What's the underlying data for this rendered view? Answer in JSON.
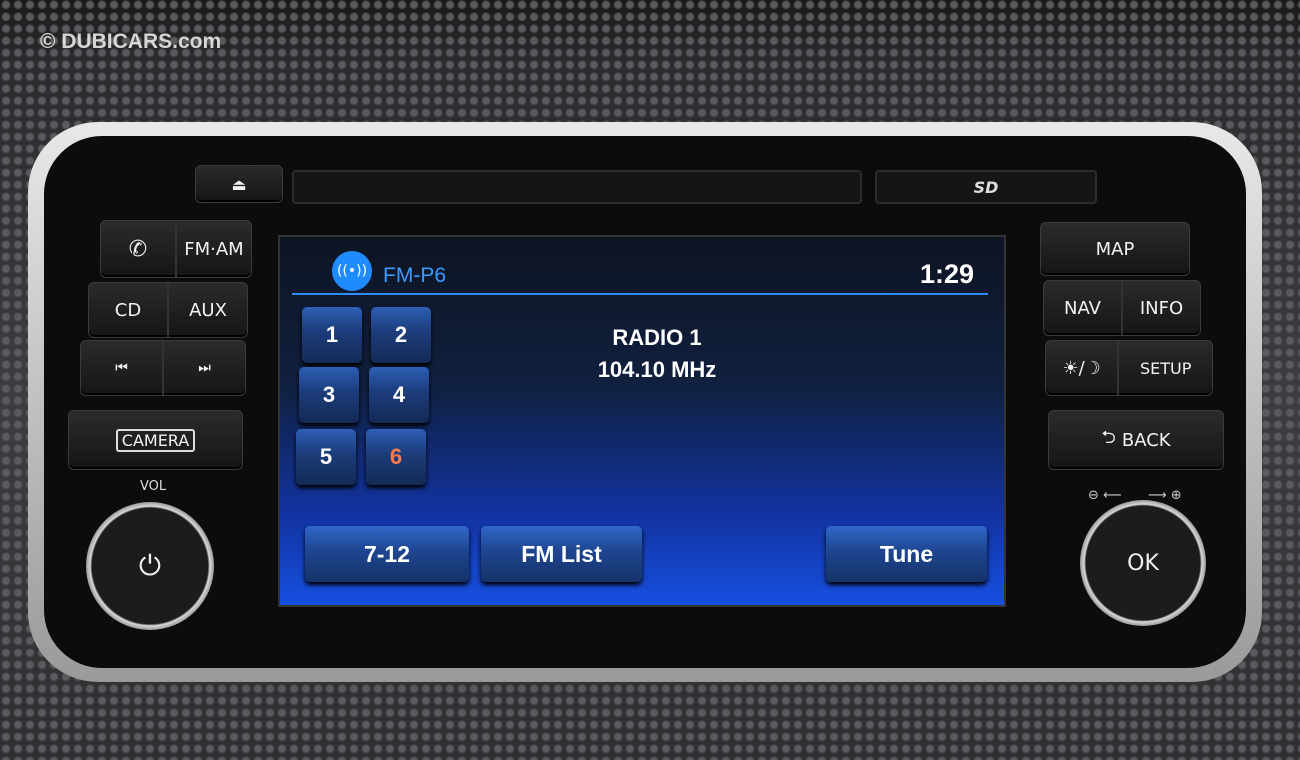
{
  "watermark": "© DUBICARS.com",
  "head_unit": {
    "eject_icon": "eject-icon",
    "sd_label": "SD",
    "left_buttons": {
      "phone_icon": "phone-icon",
      "fm_am": "FM·AM",
      "cd": "CD",
      "aux": "AUX",
      "prev_icon": "skip-back-icon",
      "next_icon": "skip-forward-icon",
      "camera": "CAMERA",
      "vol": "VOL",
      "power_icon": "power-icon"
    },
    "right_buttons": {
      "map": "MAP",
      "nav": "NAV",
      "info": "INFO",
      "daynight_icon": "sun-moon-icon",
      "setup": "SETUP",
      "back": "BACK",
      "back_icon": "back-arrow-icon",
      "ok": "OK",
      "zoom_out_icon": "zoom-out-icon",
      "zoom_in_icon": "zoom-in-icon"
    }
  },
  "screen": {
    "source_icon": "radio-broadcast-icon",
    "source": "FM-P6",
    "clock": "1:29",
    "presets": [
      {
        "label": "1"
      },
      {
        "label": "2"
      },
      {
        "label": "3"
      },
      {
        "label": "4"
      },
      {
        "label": "5"
      },
      {
        "label": "6",
        "active": true
      }
    ],
    "station_name": "RADIO 1",
    "frequency": "104.10 MHz",
    "buttons": {
      "next_presets": "7-12",
      "fm_list": "FM List",
      "tune": "Tune"
    },
    "colors": {
      "accent": "#2f8cff",
      "active_preset": "#ff7a4a"
    }
  }
}
